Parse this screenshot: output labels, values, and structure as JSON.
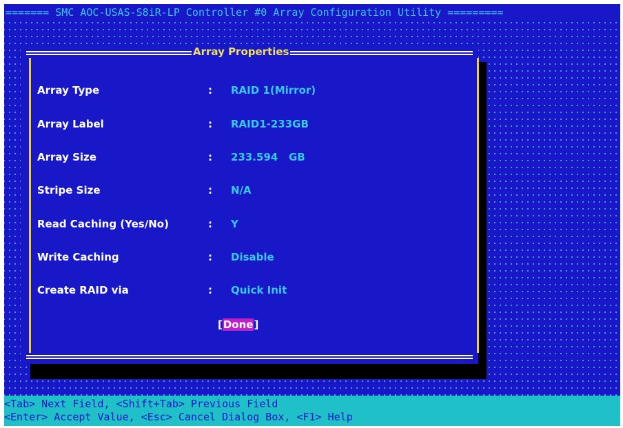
{
  "window": {
    "title": "======= SMC AOC-USAS-S8iR-LP Controller #0 Array Configuration Utility ========="
  },
  "dialog": {
    "title": "Array Properties",
    "fields": [
      {
        "label": "Array Type",
        "value": "RAID 1(Mirror)"
      },
      {
        "label": "Array Label",
        "value": "RAID1-233GB"
      },
      {
        "label": "Array Size",
        "value": "233.594   GB"
      },
      {
        "label": "Stripe Size",
        "value": "N/A"
      },
      {
        "label": "Read Caching (Yes/No)",
        "value": "Y"
      },
      {
        "label": "Write Caching",
        "value": "Disable"
      },
      {
        "label": "Create RAID via",
        "value": "Quick Init"
      }
    ],
    "separator": ":",
    "done_label": "Done",
    "done_bracket_left": "[",
    "done_bracket_right": "]"
  },
  "help": {
    "line1": "<Tab> Next Field, <Shift+Tab> Previous Field",
    "line2": "<Enter> Accept Value, <Esc> Cancel Dialog Box, <F1> Help"
  },
  "colors": {
    "background": "#1818c8",
    "title_text": "#39c8e8",
    "value_text": "#39c8e8",
    "label_text": "#ffffff",
    "border_vertical": "#f0d020",
    "dialog_title": "#f0e060",
    "done_highlight": "#c020c8",
    "help_bar": "#20c0c8"
  }
}
